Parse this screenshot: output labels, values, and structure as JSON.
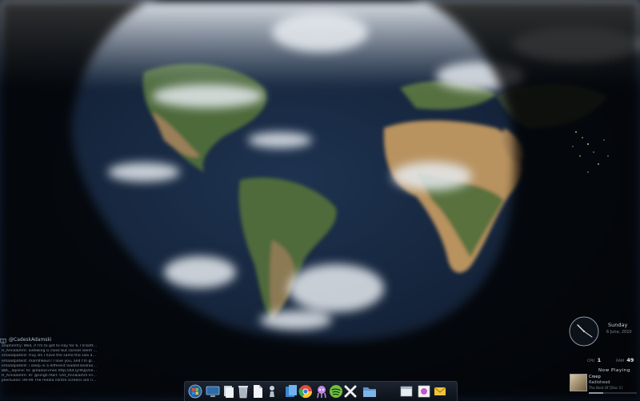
{
  "twitter": {
    "handle": "@CadeskAdamski",
    "tweets": [
      "stephenfry: Well, if I'm to get to Hay for 6, I'd better s...",
      "H_Annalamm: Sidewing is close but cannot seem to d...",
      "emaadpatent: truy shi I have the same the size as a...",
      "emaadpatent: marillhkeuri! I love you, and I'm glad y...",
      "emaadpatent: i sleep in a different loaded bedroom e...",
      "BBC_Topline: RT @RadioTimes http://bit.ly/9QjUne T...",
      "H_Annalamm: RT @singh7RBT: Unt_Annalamm Friend...",
      "jleenGeon: 09-09 The media centre screens are now s..."
    ]
  },
  "clock": {
    "day": "Sunday",
    "date": "6 June, 2010"
  },
  "stats": {
    "cpu_label": "CPU",
    "cpu_value": "1",
    "ram_label": "RAM",
    "ram_value": "49"
  },
  "now_playing": {
    "title": "Now Playing",
    "song": "Creep",
    "artist": "Radiohead",
    "album": "The Best Of [Disc 1]",
    "progress": 0.3
  },
  "taskbar": {
    "icons": [
      {
        "name": "start-orb-icon",
        "color": "#3d7fd0"
      },
      {
        "name": "display-icon",
        "color": "#5a9bd8"
      },
      {
        "name": "document-stack-icon",
        "color": "#dde3ea"
      },
      {
        "name": "recycle-bin-icon",
        "color": "#b8c2cf"
      },
      {
        "name": "document-icon",
        "color": "#e8ecf1"
      },
      {
        "name": "chess-pawn-icon",
        "color": "#c8d0da"
      },
      {
        "name": "sticky-notes-icon",
        "color": "#5aa5e8"
      },
      {
        "name": "chrome-icon",
        "color": "#e04a3a"
      },
      {
        "name": "alien-app-icon",
        "color": "#c69ce6"
      },
      {
        "name": "spotify-icon",
        "color": "#7bd148"
      },
      {
        "name": "crossed-tools-icon",
        "color": "#f0f0f0"
      },
      {
        "name": "folder-icon",
        "color": "#6aa4dc"
      },
      {
        "name": "window-icon",
        "color": "#d9dde3"
      },
      {
        "name": "painting-icon",
        "color": "#c05ac8"
      },
      {
        "name": "mail-icon",
        "color": "#f0c43a"
      }
    ]
  }
}
